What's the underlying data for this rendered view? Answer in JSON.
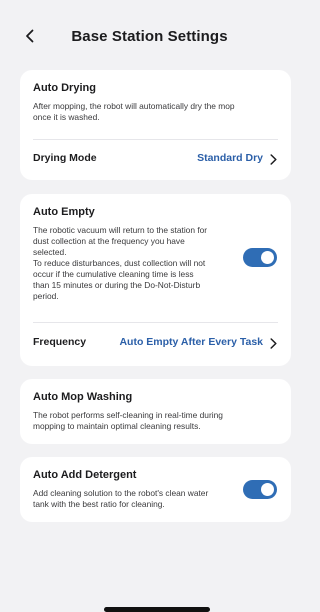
{
  "header": {
    "title": "Base Station Settings"
  },
  "auto_drying": {
    "title": "Auto Drying",
    "desc_line1": "After mopping, the robot will automatically dry the mop",
    "desc_line2": "once it is washed.",
    "mode_label": "Drying Mode",
    "mode_value": "Standard Dry"
  },
  "auto_empty": {
    "title": "Auto Empty",
    "desc_lines": [
      "The robotic vacuum will return to the station for",
      "dust collection at the frequency you have",
      "selected.",
      "To reduce disturbances, dust collection will not",
      "occur if the cumulative cleaning time is less",
      "than 15 minutes or during the Do-Not-Disturb",
      "period."
    ],
    "toggle_on": true,
    "frequency_label": "Frequency",
    "frequency_value": "Auto Empty After Every Task"
  },
  "auto_mop_washing": {
    "title": "Auto Mop Washing",
    "desc_line1": "The robot performs self-cleaning in real-time during",
    "desc_line2": "mopping to maintain optimal cleaning results."
  },
  "auto_add_detergent": {
    "title": "Auto Add Detergent",
    "desc_line1": "Add cleaning solution to the robot's clean water",
    "desc_line2": "tank with the best ratio for cleaning.",
    "toggle_on": true
  },
  "colors": {
    "background": "#f2f2f4",
    "card": "#ffffff",
    "accent": "#2f6db5",
    "link_value": "#2b5fa8"
  },
  "icons": [
    "back-chevron-icon",
    "chevron-right-icon"
  ]
}
